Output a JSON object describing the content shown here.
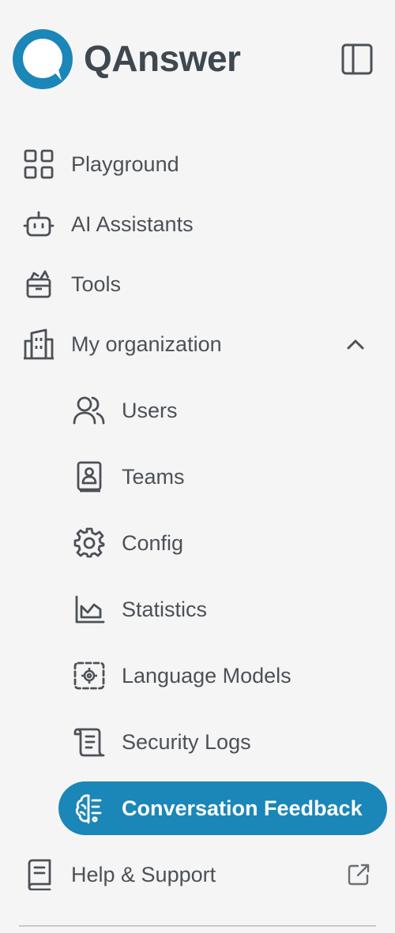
{
  "brand": {
    "name": "QAnswer",
    "color": "#1b86b8"
  },
  "header": {
    "toggle_icon": "sidebar-panel-icon"
  },
  "nav": {
    "playground": {
      "label": "Playground",
      "icon": "grid-icon"
    },
    "ai_assistants": {
      "label": "AI Assistants",
      "icon": "robot-icon"
    },
    "tools": {
      "label": "Tools",
      "icon": "toolbox-icon"
    },
    "my_organization": {
      "label": "My organization",
      "icon": "building-icon",
      "expanded": true
    },
    "sub": {
      "users": {
        "label": "Users",
        "icon": "users-icon"
      },
      "teams": {
        "label": "Teams",
        "icon": "contact-book-icon"
      },
      "config": {
        "label": "Config",
        "icon": "gear-icon"
      },
      "statistics": {
        "label": "Statistics",
        "icon": "area-chart-icon"
      },
      "language_models": {
        "label": "Language Models",
        "icon": "model-settings-icon"
      },
      "security_logs": {
        "label": "Security Logs",
        "icon": "scroll-icon"
      },
      "conversation_feedback": {
        "label": "Conversation Feedback",
        "icon": "brain-icon",
        "active": true
      }
    },
    "help_support": {
      "label": "Help & Support",
      "icon": "book-icon",
      "external_icon": "external-link-icon"
    }
  },
  "colors": {
    "active_bg": "#1b86b8",
    "text": "#4c5157",
    "background": "#f5f5f5"
  }
}
